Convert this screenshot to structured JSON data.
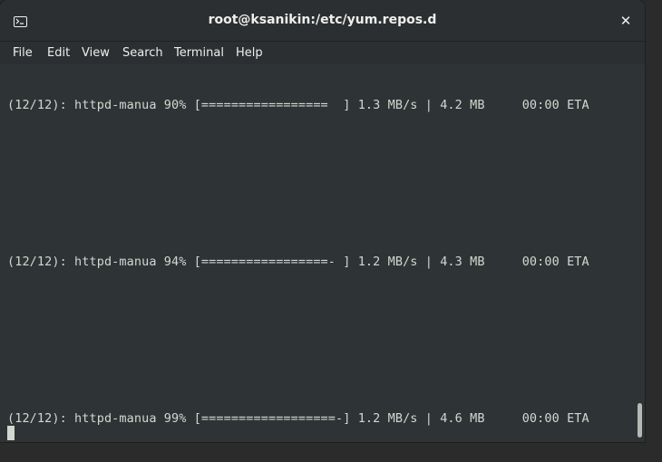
{
  "window": {
    "title": "root@ksanikin:/etc/yum.repos.d",
    "close_glyph": "✕"
  },
  "menu": {
    "items": [
      {
        "label": "File"
      },
      {
        "label": "Edit"
      },
      {
        "label": "View"
      },
      {
        "label": "Search"
      },
      {
        "label": "Terminal"
      },
      {
        "label": "Help"
      }
    ]
  },
  "terminal": {
    "lines": [
      "(12/12): httpd-manua 90% [=================  ] 1.3 MB/s | 4.2 MB     00:00 ETA",
      "(12/12): httpd-manua 94% [=================- ] 1.2 MB/s | 4.3 MB     00:00 ETA",
      "(12/12): httpd-manua 99% [==================-] 1.2 MB/s | 4.6 MB     00:00 ETA"
    ]
  },
  "icons": {
    "terminal": "terminal-icon",
    "close": "close-icon"
  },
  "colors": {
    "background": "#2e3436",
    "foreground": "#d3d7cf",
    "titlebar": "#2c2f31"
  }
}
